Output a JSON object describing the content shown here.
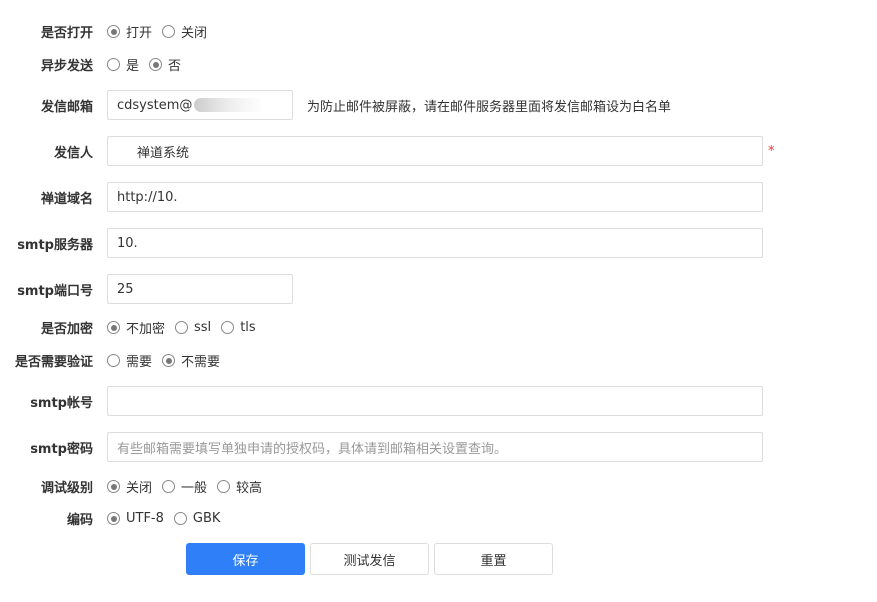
{
  "fields": {
    "open": {
      "label": "是否打开",
      "options": [
        "打开",
        "关闭"
      ],
      "selected": 0
    },
    "async": {
      "label": "异步发送",
      "options": [
        "是",
        "否"
      ],
      "selected": 1
    },
    "from_email": {
      "label": "发信邮箱",
      "value": "cdsystem@",
      "hint": "为防止邮件被屏蔽，请在邮件服务器里面将发信邮箱设为白名单"
    },
    "from_name": {
      "label": "发信人",
      "value": "禅道系统",
      "required": "*"
    },
    "domain": {
      "label": "禅道域名",
      "value": "http://10."
    },
    "smtp_host": {
      "label": "smtp服务器",
      "value": "10."
    },
    "smtp_port": {
      "label": "smtp端口号",
      "value": "25"
    },
    "secure": {
      "label": "是否加密",
      "options": [
        "不加密",
        "ssl",
        "tls"
      ],
      "selected": 0
    },
    "auth": {
      "label": "是否需要验证",
      "options": [
        "需要",
        "不需要"
      ],
      "selected": 1
    },
    "smtp_user": {
      "label": "smtp帐号",
      "value": ""
    },
    "smtp_pass": {
      "label": "smtp密码",
      "placeholder": "有些邮箱需要填写单独申请的授权码，具体请到邮箱相关设置查询。"
    },
    "debug": {
      "label": "调试级别",
      "options": [
        "关闭",
        "一般",
        "较高"
      ],
      "selected": 0
    },
    "charset": {
      "label": "编码",
      "options": [
        "UTF-8",
        "GBK"
      ],
      "selected": 0
    }
  },
  "buttons": {
    "save": "保存",
    "test": "测试发信",
    "reset": "重置"
  },
  "colors": {
    "primary": "#2e7ff8",
    "required": "#e33"
  }
}
